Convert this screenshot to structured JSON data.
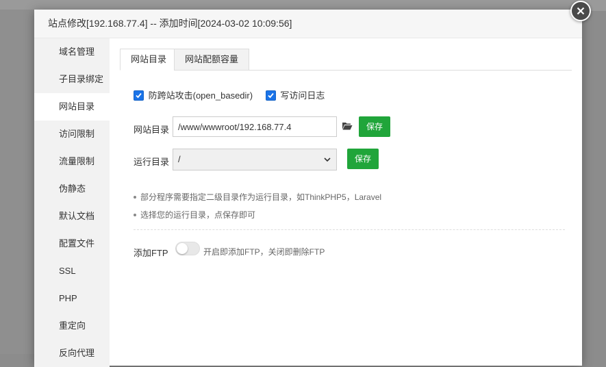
{
  "dialog": {
    "title": "站点修改[192.168.77.4] -- 添加时间[2024-03-02 10:09:56]"
  },
  "sidebar": {
    "items": [
      {
        "label": "域名管理"
      },
      {
        "label": "子目录绑定"
      },
      {
        "label": "网站目录",
        "active": true
      },
      {
        "label": "访问限制"
      },
      {
        "label": "流量限制"
      },
      {
        "label": "伪静态"
      },
      {
        "label": "默认文档"
      },
      {
        "label": "配置文件"
      },
      {
        "label": "SSL"
      },
      {
        "label": "PHP"
      },
      {
        "label": "重定向"
      },
      {
        "label": "反向代理"
      }
    ]
  },
  "tabs": [
    {
      "label": "网站目录",
      "active": true
    },
    {
      "label": "网站配额容量"
    }
  ],
  "options": {
    "anti_xss": {
      "label": "防跨站攻击(open_basedir)",
      "checked": true
    },
    "access_log": {
      "label": "写访问日志",
      "checked": true
    }
  },
  "site_dir": {
    "label": "网站目录",
    "value": "/www/wwwroot/192.168.77.4",
    "save_label": "保存"
  },
  "run_dir": {
    "label": "运行目录",
    "selected": "/",
    "save_label": "保存"
  },
  "tips": [
    "部分程序需要指定二级目录作为运行目录，如ThinkPHP5，Laravel",
    "选择您的运行目录，点保存即可"
  ],
  "ftp": {
    "label": "添加FTP",
    "enabled": false,
    "description": "开启即添加FTP，关闭即删除FTP"
  },
  "colors": {
    "primary_green": "#20a53a",
    "checkbox_blue": "#1a73e8"
  }
}
